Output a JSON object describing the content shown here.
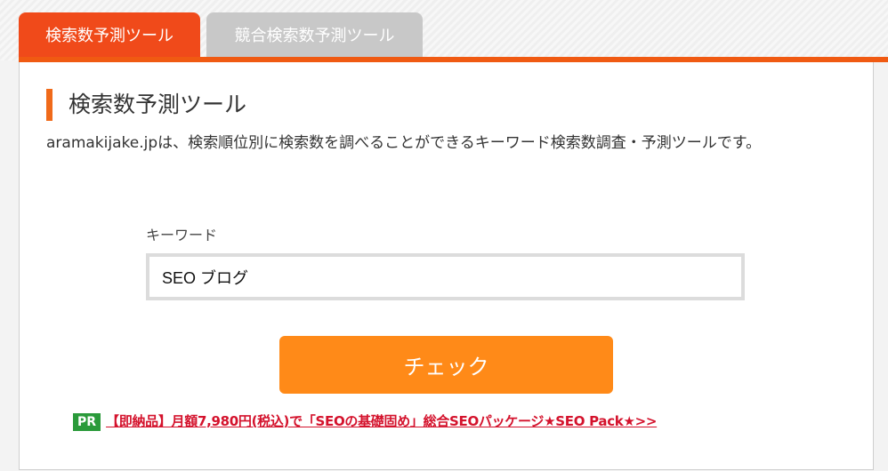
{
  "tabs": [
    {
      "label": "検索数予測ツール",
      "active": true
    },
    {
      "label": "競合検索数予測ツール",
      "active": false
    }
  ],
  "main": {
    "heading": "検索数予測ツール",
    "description": "aramakijake.jpは、検索順位別に検索数を調べることができるキーワード検索数調査・予測ツールです。"
  },
  "form": {
    "keyword_label": "キーワード",
    "keyword_value": "SEO ブログ",
    "check_button": "チェック"
  },
  "promo": {
    "badge": "PR",
    "link_text": "【即納品】月額7,980円(税込)で「SEOの基礎固め」総合SEOパッケージ★SEO Pack★>>"
  },
  "colors": {
    "accent_orange": "#f05a12",
    "active_tab": "#f04a1a",
    "button": "#ff8a18",
    "promo_link": "#d4122c",
    "pr_badge": "#2a9a3a"
  }
}
